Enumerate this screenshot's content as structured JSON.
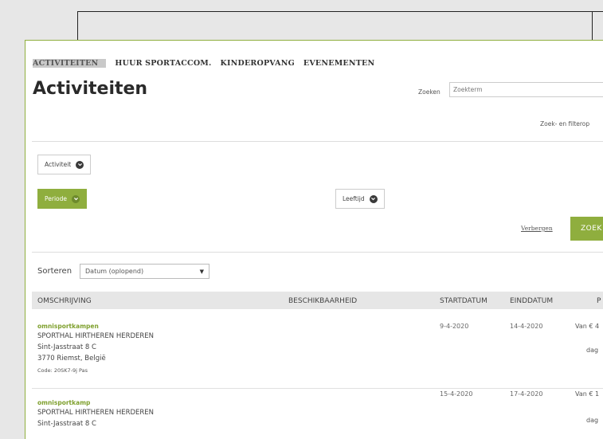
{
  "nav": {
    "items": [
      {
        "label": "ACTIVITEITEN",
        "active": true
      },
      {
        "label": "HUUR SPORTACCOM."
      },
      {
        "label": "KINDEROPVANG"
      },
      {
        "label": "EVENEMENTEN"
      }
    ]
  },
  "page_title": "Activiteiten",
  "search": {
    "label": "Zoeken",
    "placeholder": "Zoekterm"
  },
  "filters": {
    "options_link": "Zoek- en filterop",
    "activity_label": "Activiteit",
    "period_label": "Periode",
    "age_label": "Leeftijd",
    "hide_label": "Verbergen",
    "search_button": "ZOEK"
  },
  "sort": {
    "label": "Sorteren",
    "selected": "Datum (oplopend)"
  },
  "table": {
    "headers": [
      "OMSCHRIJVING",
      "BESCHIKBAARHEID",
      "STARTDATUM",
      "EINDDATUM",
      "P"
    ],
    "rows": [
      {
        "name": "omnisportkampen",
        "location": "SPORTHAL HIRTHEREN HERDEREN",
        "street": "Sint-Jasstraat 8 C",
        "city": "3770 Riemst, België",
        "code": "Code: 20SK7-9j Pas",
        "start": "9-4-2020",
        "end": "14-4-2020",
        "price": "Van € 4",
        "per": "dag"
      },
      {
        "name": "omnisportkamp",
        "location": "SPORTHAL HIRTHEREN HERDEREN",
        "street": "Sint-Jasstraat 8 C",
        "city": "",
        "code": "",
        "start": "15-4-2020",
        "end": "17-4-2020",
        "price": "Van € 1",
        "per": "dag"
      }
    ]
  },
  "colors": {
    "accent": "#8fae3e",
    "frame_border": "#8fae3e",
    "link_green": "#7fa02e"
  },
  "icons": [
    "chevron-down-circle-icon",
    "select-caret-icon"
  ]
}
